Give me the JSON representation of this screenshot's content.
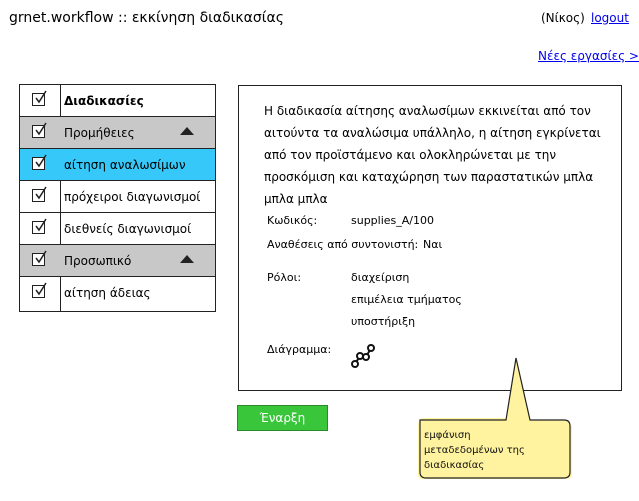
{
  "header": {
    "app_title": "grnet.workflow :: εκκίνηση διαδικασίας",
    "user": "(Νίκος)",
    "logout": "logout",
    "new_tasks": "Νέες εργασίες >"
  },
  "sidebar": {
    "rows": [
      {
        "label": "Διαδικασίες",
        "kind": "header",
        "checked": true
      },
      {
        "label": "Προμήθειες",
        "kind": "group",
        "checked": true,
        "expanded": true
      },
      {
        "label": "αίτηση αναλωσίμων",
        "kind": "item",
        "checked": true,
        "selected": true
      },
      {
        "label": "πρόχειροι διαγωνισμοί",
        "kind": "item",
        "checked": true
      },
      {
        "label": "διεθνείς διαγωνισμοί",
        "kind": "item",
        "checked": true
      },
      {
        "label": "Προσωπικό",
        "kind": "group",
        "checked": true,
        "expanded": true
      },
      {
        "label": "αίτηση άδειας",
        "kind": "item",
        "checked": true
      }
    ]
  },
  "detail": {
    "description": "Η διαδικασία αίτησης αναλωσίμων εκκινείται από τον αιτούντα τα αναλώσιμα υπάλληλο, η αίτηση εγκρίνεται από τον προϊστάμενο και ολοκληρώνεται με την προσκόμιση και καταχώρηση των παραστατικών μπλα μπλα μπλα",
    "code_label": "Κωδικός:",
    "code_value": "supplies_A/100",
    "assign_label": "Αναθέσεις από συντονιστή:",
    "assign_value": "Ναι",
    "roles_label": "Ρόλοι:",
    "roles": [
      "διαχείριση",
      "επιμέλεια τμήματος",
      "υποστήριξη"
    ],
    "diagram_label": "Διάγραμμα:"
  },
  "start_button": "Έναρξη",
  "callout": "εμφάνιση μεταδεδομένων της διαδικασίας",
  "colors": {
    "selected_row": "#36c8f8",
    "group_row": "#c8c8c8",
    "start_button": "#3ac63a",
    "callout": "#fff3a0",
    "link": "#0000ee"
  },
  "icons": {
    "checkbox": "checkbox-checked-icon",
    "collapse": "triangle-up-icon",
    "diagram": "workflow-diagram-icon"
  }
}
